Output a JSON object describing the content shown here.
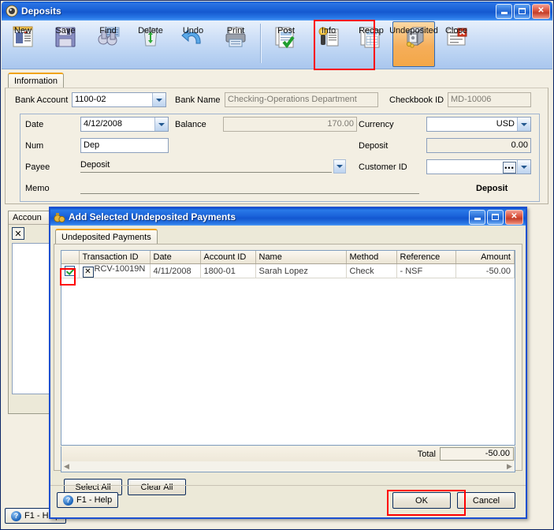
{
  "main_window": {
    "title": "Deposits",
    "icon": "deposits-window-icon",
    "controls": {
      "minimize": "minimize",
      "maximize": "maximize",
      "close": "close"
    },
    "toolbar": {
      "buttons": [
        {
          "label": "New",
          "icon": "new-document-icon"
        },
        {
          "label": "Save",
          "icon": "floppy-disk-icon"
        },
        {
          "label": "Find",
          "icon": "binoculars-icon"
        },
        {
          "label": "Delete",
          "icon": "recycle-bin-icon"
        },
        {
          "label": "Undo",
          "icon": "undo-arrow-icon"
        },
        {
          "label": "Print",
          "icon": "printer-icon"
        },
        {
          "label": "Post",
          "icon": "post-checkmark-icon"
        },
        {
          "label": "Info",
          "icon": "info-book-icon"
        },
        {
          "label": "Recap",
          "icon": "recap-pages-icon"
        },
        {
          "label": "Undeposited",
          "icon": "safe-vault-icon"
        },
        {
          "label": "Close",
          "icon": "close-document-icon"
        }
      ],
      "active_button": "Undeposited"
    },
    "tabs": [
      {
        "label": "Information",
        "selected": true
      }
    ],
    "fields": {
      "bank_account_label": "Bank Account",
      "bank_account_value": "1100-02",
      "bank_name_label": "Bank Name",
      "bank_name_value": "Checking-Operations Department",
      "checkbook_id_label": "Checkbook ID",
      "checkbook_id_value": "MD-10006",
      "date_label": "Date",
      "date_value": "4/12/2008",
      "balance_label": "Balance",
      "balance_value": "170.00",
      "currency_label": "Currency",
      "currency_value": "USD",
      "num_label": "Num",
      "num_value": "Dep",
      "deposit_label": "Deposit",
      "deposit_value": "0.00",
      "payee_label": "Payee",
      "payee_value": "Deposit",
      "customer_id_label": "Customer ID",
      "customer_id_value": "",
      "memo_label": "Memo",
      "memo_value": "",
      "deposit_total_label": "Deposit"
    },
    "bottom_grid": {
      "header": "Accoun",
      "delete_row_button": "✕"
    },
    "status": {
      "help_label": "F1 - Help",
      "help_icon": "question-mark-icon"
    }
  },
  "dialog": {
    "title": "Add Selected Undeposited Payments",
    "icon": "money-bag-icon",
    "controls": {
      "minimize": "minimize",
      "maximize": "maximize",
      "close": "close"
    },
    "tabs": [
      {
        "label": "Undeposited Payments",
        "selected": true
      }
    ],
    "grid": {
      "columns": [
        {
          "label": "",
          "name": "select-checkbox-column",
          "align": "left"
        },
        {
          "label": "Transaction ID",
          "name": "transaction-id-column",
          "align": "left"
        },
        {
          "label": "Date",
          "name": "date-column",
          "align": "left"
        },
        {
          "label": "Account ID",
          "name": "account-id-column",
          "align": "left"
        },
        {
          "label": "Name",
          "name": "name-column",
          "align": "left"
        },
        {
          "label": "Method",
          "name": "method-column",
          "align": "left"
        },
        {
          "label": "Reference",
          "name": "reference-column",
          "align": "left"
        },
        {
          "label": "Amount",
          "name": "amount-column",
          "align": "right"
        }
      ],
      "rows": [
        {
          "selected": true,
          "transaction_id": "RCV-10019N",
          "date": "4/11/2008",
          "account_id": "1800-01",
          "name": "Sarah  Lopez",
          "method": "Check",
          "reference": "- NSF",
          "amount": "-50.00"
        }
      ]
    },
    "total_label": "Total",
    "total_value": "-50.00",
    "buttons": {
      "select_all": "Select All",
      "clear_all": "Clear All",
      "help": "F1 - Help",
      "ok": "OK",
      "cancel": "Cancel"
    }
  },
  "annotations": {
    "highlight_color": "#ff0000",
    "boxes": [
      {
        "name": "undeposited-toolbar-highlight"
      },
      {
        "name": "row-checkbox-highlight"
      },
      {
        "name": "ok-button-highlight"
      }
    ]
  }
}
